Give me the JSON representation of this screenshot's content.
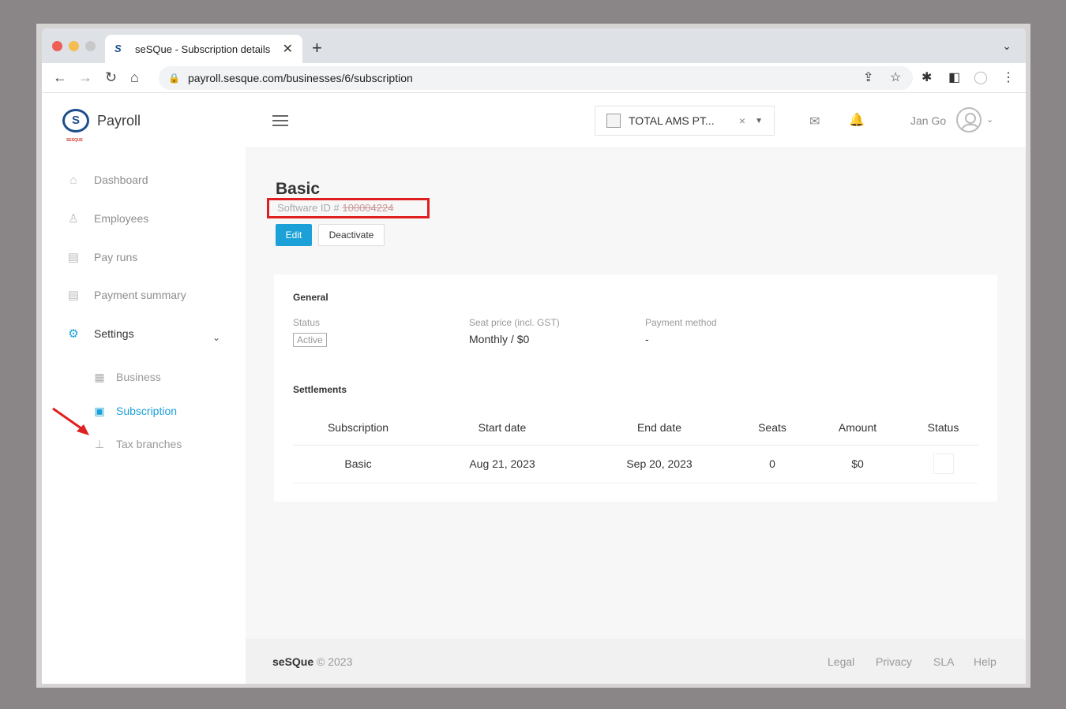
{
  "browser": {
    "tab_title": "seSQue - Subscription details",
    "url": "payroll.sesque.com/businesses/6/subscription"
  },
  "sidebar": {
    "brand_name": "Payroll",
    "brand_logo_text": "S",
    "brand_logo_sub": "SESQUE",
    "items": [
      {
        "label": "Dashboard",
        "icon": "home-icon"
      },
      {
        "label": "Employees",
        "icon": "users-icon"
      },
      {
        "label": "Pay runs",
        "icon": "document-icon"
      },
      {
        "label": "Payment summary",
        "icon": "document-icon"
      },
      {
        "label": "Settings",
        "icon": "gear-icon"
      }
    ],
    "sub_items": [
      {
        "label": "Business",
        "icon": "building-icon"
      },
      {
        "label": "Subscription",
        "icon": "calendar-icon"
      },
      {
        "label": "Tax branches",
        "icon": "sitemap-icon"
      }
    ]
  },
  "topbar": {
    "business_name": "TOTAL AMS PT...",
    "user_name": "Jan Go"
  },
  "main": {
    "title": "Basic",
    "software_id_label": "Software ID #",
    "software_id_redacted": "100004224",
    "edit_label": "Edit",
    "deactivate_label": "Deactivate",
    "general_title": "General",
    "status_label": "Status",
    "status_value": "Active",
    "seat_price_label": "Seat price (incl. GST)",
    "seat_price_value": "Monthly / $0",
    "payment_method_label": "Payment method",
    "payment_method_value": "-",
    "settlements_title": "Settlements",
    "columns": [
      "Subscription",
      "Start date",
      "End date",
      "Seats",
      "Amount",
      "Status"
    ],
    "rows": [
      [
        "Basic",
        "Aug 21, 2023",
        "Sep 20, 2023",
        "0",
        "$0",
        ""
      ]
    ]
  },
  "footer": {
    "brand": "seSQue",
    "copyright": "© 2023",
    "links": [
      "Legal",
      "Privacy",
      "SLA",
      "Help"
    ]
  },
  "colors": {
    "accent": "#1ba1d8",
    "highlight_box": "#e02020",
    "annotation_arrow": "#e02020"
  }
}
